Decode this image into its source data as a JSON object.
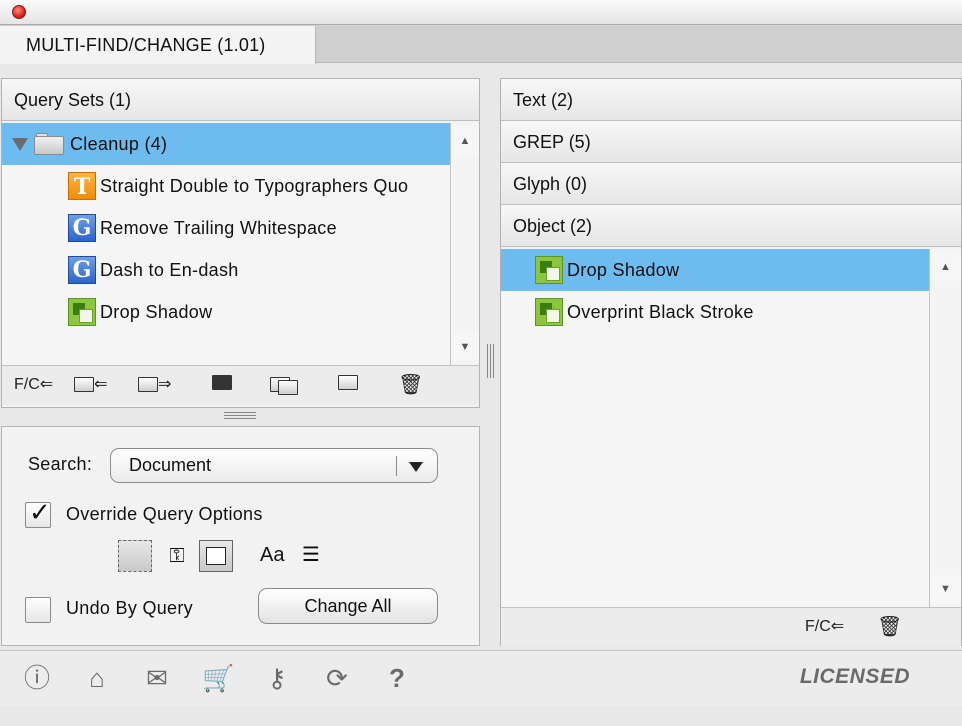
{
  "window": {
    "tab_title": "MULTI-FIND/CHANGE (1.01)"
  },
  "left_panel": {
    "header": "Query Sets (1)",
    "tree": [
      {
        "label": "Cleanup (4)",
        "type": "folder",
        "selected": true
      },
      {
        "label": "Straight Double to Typographers Quo",
        "type": "text"
      },
      {
        "label": "Remove Trailing Whitespace",
        "type": "grep"
      },
      {
        "label": "Dash to En-dash",
        "type": "grep"
      },
      {
        "label": "Drop Shadow",
        "type": "object"
      }
    ],
    "toolbar": {
      "fc_label": "F/C⇐",
      "icons": [
        "load-query-icon",
        "folder-in-icon",
        "folder-out-icon",
        "import-icon",
        "duplicate-folder-icon",
        "new-folder-icon",
        "trash-icon"
      ]
    }
  },
  "right_panel": {
    "sections": [
      "Text (2)",
      "GREP (5)",
      "Glyph (0)",
      "Object (2)"
    ],
    "list": [
      {
        "label": "Drop Shadow",
        "type": "object",
        "selected": true
      },
      {
        "label": "Overprint Black Stroke",
        "type": "object"
      }
    ],
    "toolbar": {
      "fc_label": "F/C⇐"
    }
  },
  "options": {
    "search_label": "Search:",
    "search_value": "Document",
    "override_label": "Override Query Options",
    "override_checked": true,
    "undo_label": "Undo By Query",
    "undo_checked": false,
    "change_all_label": "Change All",
    "option_icons": [
      "hidden-layers-icon",
      "locked-items-icon",
      "master-pages-icon",
      "case-sensitive-icon",
      "whole-word-icon"
    ],
    "option_glyph_case": "Aa"
  },
  "footer": {
    "icons": [
      "info-icon",
      "home-icon",
      "mail-icon",
      "cart-icon",
      "key-icon",
      "refresh-icon",
      "help-icon"
    ],
    "status": "LICENSED"
  },
  "colors": {
    "selection": "#6dbbef",
    "text_icon": "#f08c00",
    "grep_icon": "#2b65c9",
    "object_icon": "#8cc63f"
  }
}
